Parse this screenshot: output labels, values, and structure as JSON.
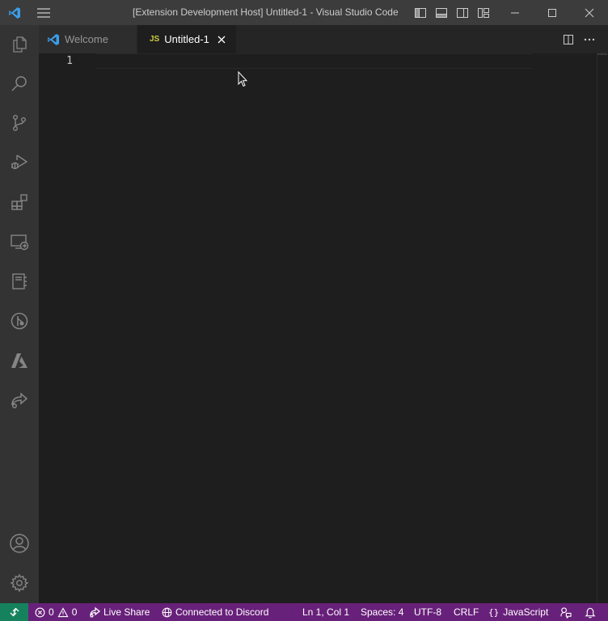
{
  "titlebar": {
    "title": "[Extension Development Host] Untitled-1 - Visual Studio Code",
    "icons": [
      "vscode-logo-icon",
      "menu-icon",
      "toggle-primary-sidebar-icon",
      "toggle-panel-icon",
      "toggle-secondary-sidebar-icon",
      "customize-layout-icon",
      "minimize-icon",
      "maximize-icon",
      "close-icon"
    ]
  },
  "activitybar": {
    "items": [
      "explorer-icon",
      "search-icon",
      "source-control-icon",
      "run-and-debug-icon",
      "extensions-icon",
      "remote-explorer-icon",
      "notebook-icon",
      "gitlens-icon",
      "azure-icon",
      "live-share-icon"
    ],
    "bottom": [
      "accounts-icon",
      "manage-gear-icon"
    ]
  },
  "tabs": [
    {
      "label": "Welcome",
      "icon": "vscode-logo-icon",
      "active": false
    },
    {
      "label": "Untitled-1",
      "icon_text": "JS",
      "active": true
    }
  ],
  "editor": {
    "line_numbers": [
      "1"
    ],
    "actions": [
      "split-editor-icon",
      "more-actions-icon"
    ]
  },
  "statusbar": {
    "errors": "0",
    "warnings": "0",
    "live_share": "Live Share",
    "discord": "Connected to Discord",
    "position": "Ln 1, Col 1",
    "spaces": "Spaces: 4",
    "encoding": "UTF-8",
    "eol": "CRLF",
    "language": "JavaScript"
  },
  "colors": {
    "titlebar": "#3c3c3c",
    "activitybar": "#333333",
    "editor": "#1e1e1e",
    "statusbar": "#68217a",
    "remote": "#16825d",
    "js_badge": "#cbcb41"
  }
}
